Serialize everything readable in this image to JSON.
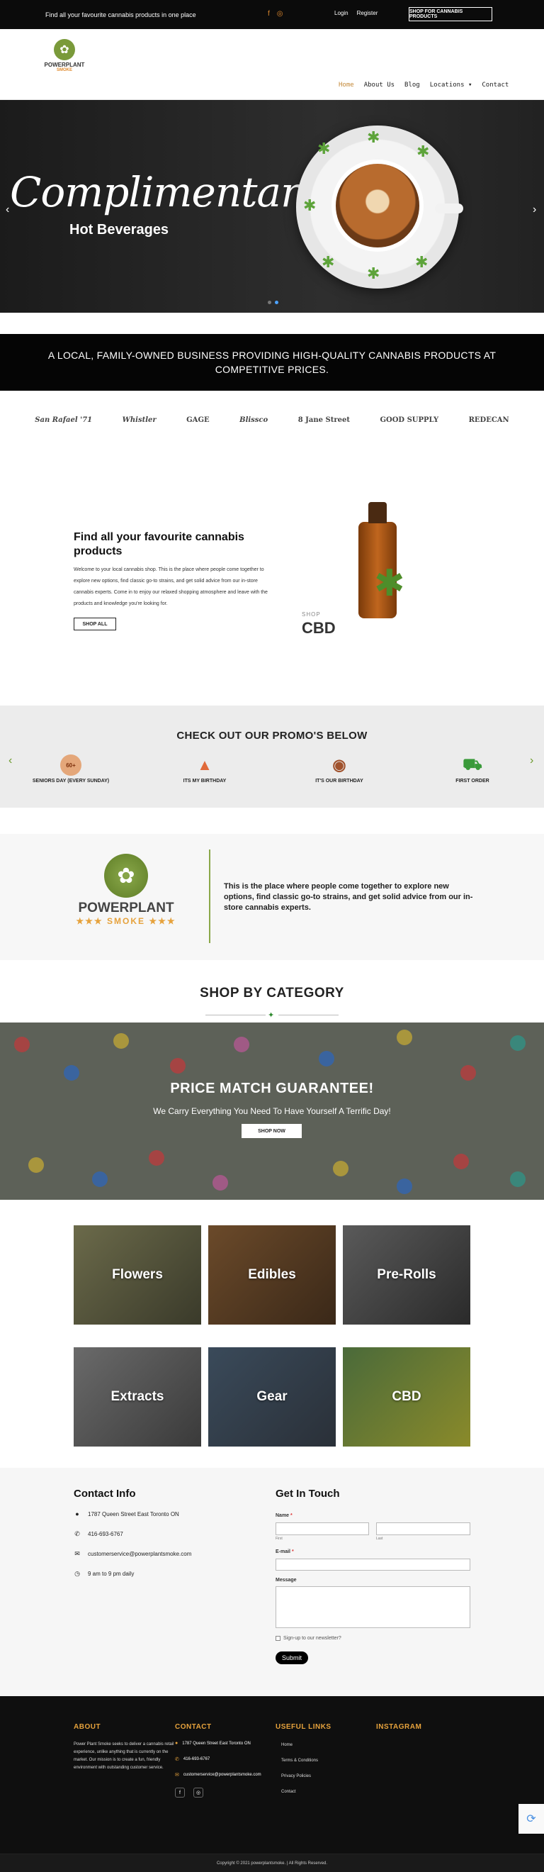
{
  "topbar": {
    "message": "Find all your favourite cannabis products in one place",
    "login": "Login",
    "register": "Register",
    "shop_button": "SHOP FOR CANNABIS PRODUCTS"
  },
  "logo": {
    "line1": "POWERPLANT",
    "line2": "SMOKE"
  },
  "nav": {
    "items": [
      "Home",
      "About Us",
      "Blog",
      "Locations",
      "Contact"
    ]
  },
  "hero": {
    "script": "Complimentary",
    "subtitle": "Hot Beverages"
  },
  "banner": {
    "line1": "A LOCAL, FAMILY-OWNED BUSINESS PROVIDING HIGH-QUALITY CANNABIS PRODUCTS AT",
    "line2": "COMPETITIVE PRICES."
  },
  "brands": [
    "San Rafael '71",
    "Whistler",
    "GAGE",
    "Blissco",
    "8 Jane Street",
    "GOOD SUPPLY",
    "REDECAN"
  ],
  "intro": {
    "title": "Find all your favourite cannabis products",
    "body": "Welcome to your local cannabis shop. This is the place where people come together to explore new options, find classic go-to strains, and get solid advice from our in-store cannabis experts. Come in to enjoy our relaxed shopping atmosphere and leave with the products and knowledge you're looking for.",
    "button": "SHOP ALL",
    "shop_label": "SHOP",
    "cbd_label": "CBD"
  },
  "promos": {
    "title": "CHECK OUT OUR PROMO'S BELOW",
    "items": [
      {
        "label": "SENIORS DAY (EVERY SUNDAY)",
        "icon": "badge-60"
      },
      {
        "label": "ITS MY BIRTHDAY",
        "icon": "party-hat-icon"
      },
      {
        "label": "IT'S OUR BIRTHDAY",
        "icon": "cake-icon"
      },
      {
        "label": "FIRST ORDER",
        "icon": "cart-icon"
      }
    ],
    "badge_text": "60+"
  },
  "about": {
    "logo_line1": "POWERPLANT",
    "logo_line2": "★★★ SMOKE ★★★",
    "text": "This is the place where people come together to explore new options, find classic go-to strains, and get solid advice from our in-store cannabis experts."
  },
  "category": {
    "title": "SHOP BY CATEGORY",
    "price_match_title": "PRICE MATCH GUARANTEE!",
    "price_match_sub": "We Carry Everything You Need To Have Yourself A Terrific Day!",
    "shop_now": "SHOP NOW",
    "tiles": [
      "Flowers",
      "Edibles",
      "Pre-Rolls",
      "Extracts",
      "Gear",
      "CBD"
    ]
  },
  "contact": {
    "title": "Contact Info",
    "address": "1787 Queen Street East Toronto ON",
    "phone": "416-693-6767",
    "email": "customerservice@powerplantsmoke.com",
    "hours": "9 am to 9 pm daily"
  },
  "form": {
    "title": "Get In Touch",
    "name_label": "Name",
    "first_hint": "First",
    "last_hint": "Last",
    "email_label": "E-mail",
    "message_label": "Message",
    "newsletter": "Sign-up to our newsletter?",
    "submit": "Submit",
    "required_mark": "*"
  },
  "footer": {
    "about_title": "ABOUT",
    "about_text": "Power Plant Smoke seeks to deliver a cannabis retail experience, unlike anything that is currently on the market. Our mission is to create a fun, friendly environment with outstanding customer service.",
    "contact_title": "CONTACT",
    "address": "1787 Queen Street East Toronto ON",
    "phone": "416-693-6767",
    "email": "customerservice@powerplantsmoke.com",
    "links_title": "USEFUL LINKS",
    "links": [
      "Home",
      "Terms & Conditions",
      "Privacy Policies",
      "Contact"
    ],
    "instagram_title": "INSTAGRAM",
    "copyright": "Copyright © 2021 powerplantsmoke. | All Rights Reserved."
  },
  "colors": {
    "accent": "#e6a23c",
    "green": "#7a9a3a",
    "dark": "#0b0b0b"
  }
}
